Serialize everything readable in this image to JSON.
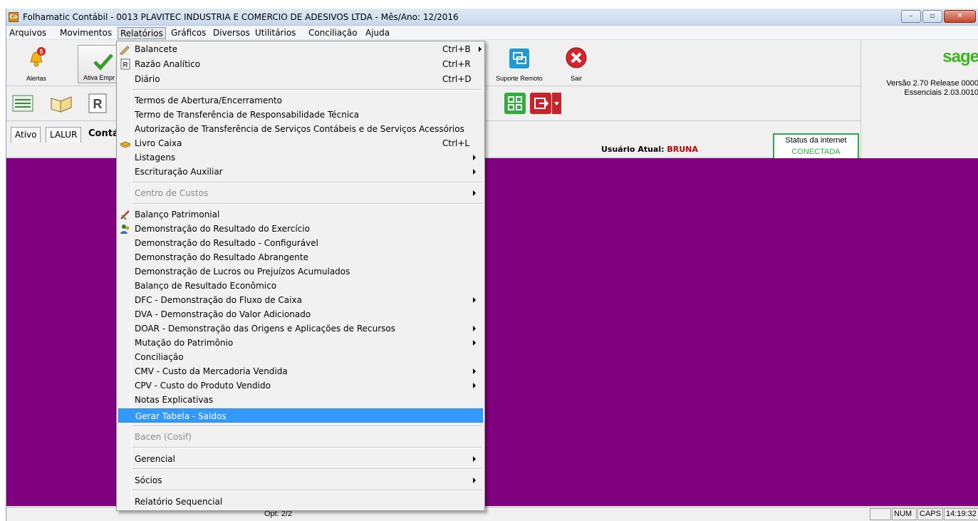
{
  "window": {
    "title": "Folhamatic Contábil - 0013 PLAVITEC INDUSTRIA E COMERCIO DE ADESIVOS LTDA - Mês/Ano: 12/2016",
    "icon_text": "Co",
    "controls": {
      "minimize": "–",
      "maximize": "▫",
      "close": "✕"
    }
  },
  "menubar": [
    "Arquivos",
    "Movimentos",
    "Relatórios",
    "Gráficos",
    "Diversos",
    "Utilitários",
    "Conciliação",
    "Ajuda"
  ],
  "toolbar": {
    "alerts_label": "Alertas",
    "alerts_badge": "5",
    "ativa_label": "Ativa Empr",
    "suporte_label": "Suporte Remoto",
    "sair_label": "Sair"
  },
  "brand": {
    "logo": "sage",
    "version_line1": "Versão 2.70 Release 0000",
    "version_line2": "Essenciais 2.03.0010"
  },
  "tabs": [
    "Ativo",
    "LALUR",
    "Contá"
  ],
  "user": {
    "label": "Usuário Atual:",
    "name": "BRUNA"
  },
  "internet": {
    "title": "Status da internet",
    "status": "CONECTADA"
  },
  "statusbar": {
    "opt": "Opt: 2/2",
    "num": "NUM",
    "caps": "CAPS",
    "time": "14:19:32"
  },
  "colors": {
    "workarea": "#800080",
    "highlight": "#3399ff",
    "connected": "#2eaa4a",
    "user_name": "#c00000"
  },
  "menu": {
    "items": [
      {
        "label": "Balancete",
        "shortcut": "Ctrl+B",
        "submenu": true,
        "icon": "pencil-icon"
      },
      {
        "label": "Razão Analítico",
        "shortcut": "Ctrl+R",
        "icon": "report-r-icon"
      },
      {
        "label": "Diário",
        "shortcut": "Ctrl+D"
      },
      {
        "label": "Termos de Abertura/Encerramento"
      },
      {
        "label": "Termo de Transferência de Responsabilidade Técnica"
      },
      {
        "label": "Autorização de Transferência de Serviços Contábeis e de Serviços Acessórios"
      },
      {
        "label": "Livro Caixa",
        "shortcut": "Ctrl+L",
        "icon": "book-stack-icon"
      },
      {
        "label": "Listagens",
        "submenu": true
      },
      {
        "label": "Escrituração Auxiliar",
        "submenu": true
      },
      {
        "label": "Centro de Custos",
        "submenu": true,
        "disabled": true
      },
      {
        "label": "Balanço Patrimonial",
        "icon": "pencil-ruler-icon"
      },
      {
        "label": "Demonstração do Resultado do Exercício",
        "icon": "users-icon"
      },
      {
        "label": "Demonstração do Resultado - Configurável"
      },
      {
        "label": "Demonstração do Resultado Abrangente"
      },
      {
        "label": "Demonstração de Lucros ou Prejuízos Acumulados"
      },
      {
        "label": "Balanço de Resultado Econômico"
      },
      {
        "label": "DFC - Demonstração do Fluxo de Caixa",
        "submenu": true
      },
      {
        "label": "DVA - Demonstração do Valor Adicionado"
      },
      {
        "label": "DOAR - Demonstração das Origens e Aplicações de Recursos",
        "submenu": true
      },
      {
        "label": "Mutação do Patrimônio",
        "submenu": true
      },
      {
        "label": "Conciliação"
      },
      {
        "label": "CMV - Custo da Mercadoria Vendida",
        "submenu": true
      },
      {
        "label": "CPV - Custo do Produto Vendido",
        "submenu": true
      },
      {
        "label": "Notas Explicativas"
      },
      {
        "label": "Gerar Tabela - Saldos",
        "highlighted": true
      },
      {
        "label": "Bacen (Cosif)",
        "disabled": true
      },
      {
        "label": "Gerencial",
        "submenu": true
      },
      {
        "label": "Sócios",
        "submenu": true
      },
      {
        "label": "Relatório Sequencial"
      }
    ]
  }
}
